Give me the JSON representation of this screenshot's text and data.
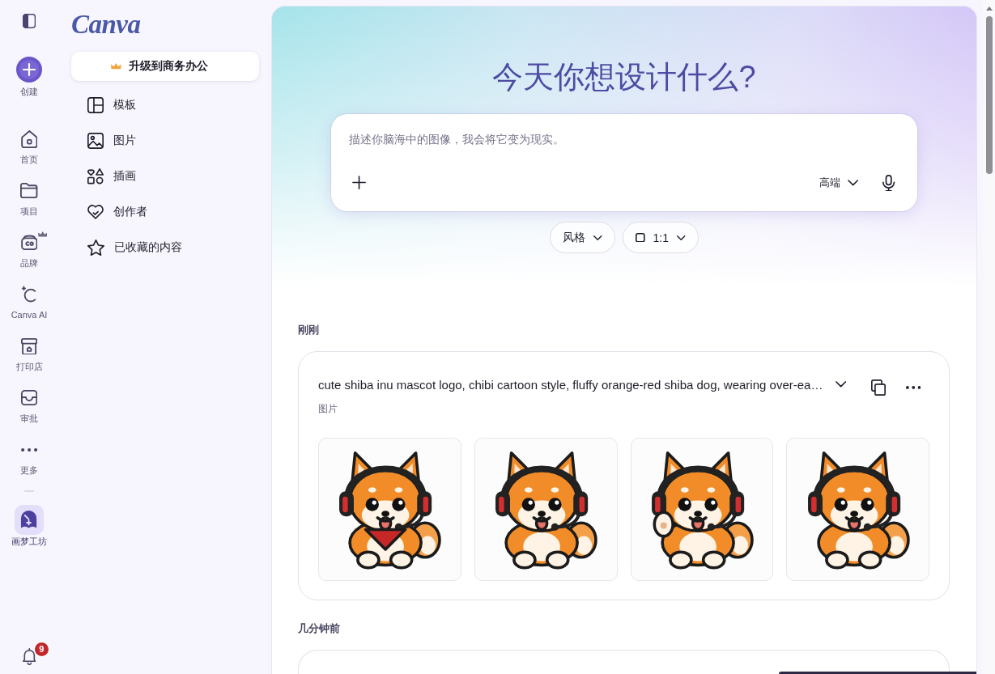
{
  "rail": {
    "create": {
      "label": "创建"
    },
    "items": [
      {
        "kind": "home",
        "label": "首页",
        "selected": false,
        "premium": false
      },
      {
        "kind": "projects",
        "label": "项目",
        "selected": false,
        "premium": false
      },
      {
        "kind": "brand",
        "label": "品牌",
        "selected": false,
        "premium": true
      },
      {
        "kind": "ai",
        "label": "Canva AI",
        "selected": false,
        "premium": false
      },
      {
        "kind": "print",
        "label": "打印店",
        "selected": false,
        "premium": false
      },
      {
        "kind": "approvals",
        "label": "审批",
        "selected": false,
        "premium": false
      },
      {
        "kind": "more",
        "label": "更多",
        "selected": false,
        "premium": false
      }
    ],
    "pinned": [
      {
        "label": "画梦工坊",
        "selected": true
      }
    ],
    "notifications": {
      "count": "9"
    }
  },
  "panel": {
    "logo": "Canva",
    "upgrade_button": "升级到商务办公",
    "items": [
      {
        "kind": "templates",
        "label": "模板",
        "selected": false
      },
      {
        "kind": "images",
        "label": "图片",
        "selected": false
      },
      {
        "kind": "illustrations",
        "label": "插画",
        "selected": false
      },
      {
        "kind": "creators",
        "label": "创作者",
        "selected": false
      },
      {
        "kind": "starred",
        "label": "已收藏的内容",
        "selected": false
      }
    ]
  },
  "main": {
    "title": "今天你想设计什么?",
    "prompt": {
      "placeholder": "描述你脑海中的图像，我会将它变为现实。",
      "quality": "高端"
    },
    "options": [
      {
        "kind": "style",
        "label": "风格"
      },
      {
        "kind": "ratio",
        "label": "1:1"
      }
    ],
    "history": [
      {
        "heading": "刚刚",
        "cards": [
          {
            "kind": "result",
            "prompt": "cute shiba inu mascot logo, chibi cartoon style, fluffy orange-red shiba dog, wearing over-ea…",
            "type": "图片",
            "images": [
              {
                "kind": "bandana"
              },
              {
                "kind": "lying"
              },
              {
                "kind": "waving"
              },
              {
                "kind": "lying"
              }
            ]
          }
        ]
      },
      {
        "heading": "几分钟前",
        "cards": [
          {
            "kind": "clipped"
          }
        ]
      }
    ]
  }
}
